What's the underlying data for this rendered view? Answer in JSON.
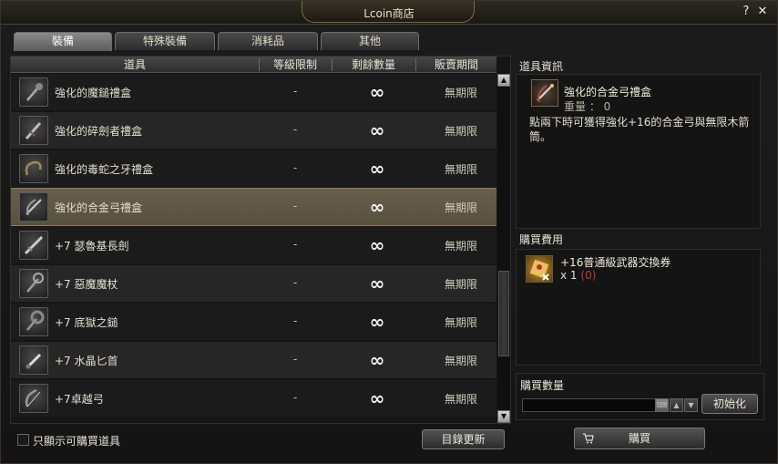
{
  "window": {
    "title": "Lcoin商店",
    "help_label": "?",
    "close_label": "✕"
  },
  "tabs": [
    {
      "label": "裝備",
      "active": true
    },
    {
      "label": "特殊裝備",
      "active": false
    },
    {
      "label": "消耗品",
      "active": false
    },
    {
      "label": "其他",
      "active": false
    }
  ],
  "table": {
    "headers": {
      "item": "道具",
      "level": "等級限制",
      "remaining": "剩餘數量",
      "period": "販賣期間"
    },
    "rows": [
      {
        "name": "強化的魔鎚禮盒",
        "level": "-",
        "qty": "∞",
        "period": "無期限",
        "icon": "mace-icon",
        "selected": false
      },
      {
        "name": "強化的碎劍者禮盒",
        "level": "-",
        "qty": "∞",
        "period": "無期限",
        "icon": "sword-breaker-icon",
        "selected": false
      },
      {
        "name": "強化的毒蛇之牙禮盒",
        "level": "-",
        "qty": "∞",
        "period": "無期限",
        "icon": "snake-fang-icon",
        "selected": false
      },
      {
        "name": "強化的合金弓禮盒",
        "level": "-",
        "qty": "∞",
        "period": "無期限",
        "icon": "alloy-bow-icon",
        "selected": true
      },
      {
        "name": "+7 瑟魯基長劍",
        "level": "-",
        "qty": "∞",
        "period": "無期限",
        "icon": "long-sword-icon",
        "selected": false
      },
      {
        "name": "+7 惡魔魔杖",
        "level": "-",
        "qty": "∞",
        "period": "無期限",
        "icon": "demon-staff-icon",
        "selected": false
      },
      {
        "name": "+7 底獄之鎚",
        "level": "-",
        "qty": "∞",
        "period": "無期限",
        "icon": "hell-hammer-icon",
        "selected": false
      },
      {
        "name": "+7 水晶匕首",
        "level": "-",
        "qty": "∞",
        "period": "無期限",
        "icon": "crystal-dagger-icon",
        "selected": false
      },
      {
        "name": "+7卓越弓",
        "level": "-",
        "qty": "∞",
        "period": "無期限",
        "icon": "excellent-bow-icon",
        "selected": false
      }
    ]
  },
  "filter": {
    "label": "只顯示可購買道具",
    "checked": false
  },
  "refresh_button": "目錄更新",
  "item_info": {
    "section_title": "道具資訊",
    "name": "強化的合金弓禮盒",
    "weight": "重量 ： 0",
    "description": "點兩下時可獲得強化+16的合金弓與無限木箭筒。"
  },
  "cost": {
    "section_title": "購買費用",
    "item_name": "+16普通級武器交換券",
    "amount_prefix": "x 1",
    "amount_owned": "(0)",
    "owned_color": "#c0392b"
  },
  "purchase": {
    "section_title": "購買數量",
    "quantity_value": "",
    "reset_button": "初始化",
    "buy_button": "購買"
  }
}
